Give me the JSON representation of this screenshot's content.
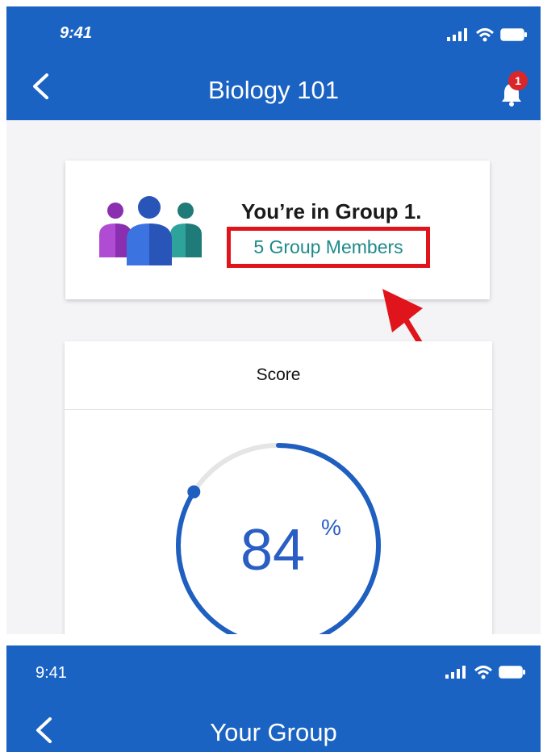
{
  "screen1": {
    "status": {
      "time": "9:41"
    },
    "header": {
      "title": "Biology 101",
      "notification_count": "1"
    },
    "group_card": {
      "title": "You’re in Group 1.",
      "members_link": "5 Group Members"
    },
    "score_card": {
      "label": "Score",
      "value": "84",
      "unit": "%",
      "progress_fraction": 0.84
    }
  },
  "screen2": {
    "status": {
      "time": "9:41"
    },
    "header": {
      "title": "Your Group"
    }
  },
  "colors": {
    "brand": "#1b63c2",
    "link": "#1f8a8a",
    "highlight": "#e0141b",
    "ring": "#1e5fc0"
  }
}
